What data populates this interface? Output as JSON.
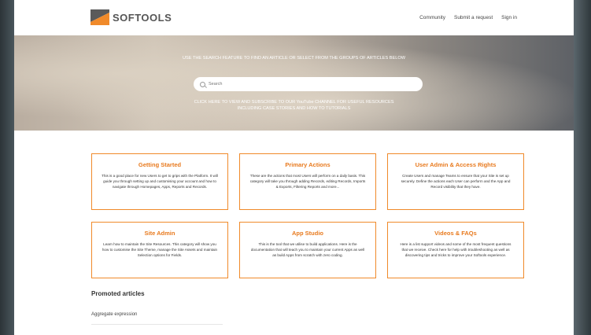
{
  "brand": {
    "name": "SOFTOOLS",
    "colors": {
      "accent": "#f08a2a",
      "accent_dark": "#5a5a5a",
      "text": "#333333"
    }
  },
  "nav": {
    "items": [
      "Community",
      "Submit a request",
      "Sign in"
    ]
  },
  "hero": {
    "instruction": "USE THE SEARCH FEATURE TO FIND AN ARTICLE OR SELECT FROM THE GROUPS OF ARTICLES BELOW",
    "search_placeholder": "Search",
    "youtube_text": "CLICK HERE TO VIEW AND SUBSCRIBE TO OUR YouTube CHANNEL FOR USEFUL RESOURCES INCLUDING CASE STORIES AND HOW TO TUTORIALS"
  },
  "categories": [
    {
      "title": "Getting Started",
      "description": "This is a good place for new Users to get to grips with the Platform. It will guide you through setting up and customising your account and how to navigate through Homepages, Apps, Reports and Records."
    },
    {
      "title": "Primary Actions",
      "description": "These are the actions that most Users will perform on a daily basis. This category will take you through adding Records, editing Records, Imports & Exports, Filtering Reports and more..."
    },
    {
      "title": "User Admin & Access Rights",
      "description": "Create Users and manage Teams to ensure that your Site is set up securely. Define the actions each User can perform and the App and Record visibility that they have."
    },
    {
      "title": "Site Admin",
      "description": "Learn how to maintain the Site Resources. This category will show you how to customise the Site Theme, manage the Site Assets and maintain Selection options for Fields."
    },
    {
      "title": "App Studio",
      "description": "This is the tool that we utilise to build applications. Here is the documentation that will teach you to maintain your current Apps as well as build Apps from scratch with zero coding."
    },
    {
      "title": "Videos & FAQs",
      "description": "Here is a list support videos and some of the most frequent questions that we receive. Check here for help with troubleshooting as well as discovering tips and tricks to improve your Softools experience."
    }
  ],
  "promoted": {
    "title": "Promoted articles",
    "items": [
      "Aggregate expression"
    ]
  }
}
